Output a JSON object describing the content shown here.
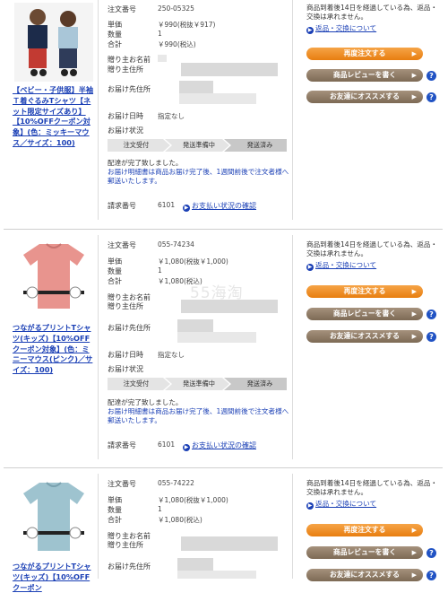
{
  "orders": [
    {
      "product_name": "【ベビー・子供服】半袖Ｔ着ぐるみTシャツ【ネット限定サイズあり】【10%OFFクーポン対象】(色：ミッキーマウス／サイズ：100)",
      "order_no_label": "注文番号",
      "order_no": "250-05325",
      "price_label": "単価",
      "price": "￥990(税抜￥917)",
      "qty_label": "数量",
      "qty": "1",
      "total_label": "合計",
      "total": "￥990(税込)",
      "recipient_name_label": "贈り主お名前",
      "recipient_address_label": "贈り主住所",
      "delivery_label": "お届け先住所",
      "delivery_date_label": "お届け日時",
      "delivery_date": "指定なし",
      "status_label": "お届け状況",
      "steps": [
        "注文受付",
        "発送準備中",
        "発送済み"
      ],
      "message_line1": "配達が完了致しました。",
      "message_line2": "お届け明細書は商品お届け完了後、1週間前後で注文者様へ郵送いたします。",
      "billing_label": "請求番号",
      "billing_no": "6101",
      "payment_link": "お支払い状況の確認",
      "return_note": "商品到着後14日を経過している為、返品・交換は承れません。",
      "return_link": "返品・交換について",
      "btn_reorder": "再度注文する",
      "btn_review": "商品レビューを書く",
      "btn_recommend": "お友達にオススメする"
    },
    {
      "product_name": "つながるプリントTシャツ(キッズ)【10%OFFクーポン対象】(色：ミニーマウス(ピンク)／サイズ：100)",
      "order_no_label": "注文番号",
      "order_no": "055-74234",
      "price_label": "単価",
      "price": "￥1,080(税抜￥1,000)",
      "qty_label": "数量",
      "qty": "1",
      "total_label": "合計",
      "total": "￥1,080(税込)",
      "recipient_name_label": "贈り主お名前",
      "recipient_address_label": "贈り主住所",
      "delivery_label": "お届け先住所",
      "delivery_date_label": "お届け日時",
      "delivery_date": "指定なし",
      "status_label": "お届け状況",
      "steps": [
        "注文受付",
        "発送準備中",
        "発送済み"
      ],
      "message_line1": "配達が完了致しました。",
      "message_line2": "お届け明細書は商品お届け完了後、1週間前後で注文者様へ郵送いたします。",
      "billing_label": "請求番号",
      "billing_no": "6101",
      "payment_link": "お支払い状況の確認",
      "return_note": "商品到着後14日を経過している為、返品・交換は承れません。",
      "return_link": "返品・交換について",
      "btn_reorder": "再度注文する",
      "btn_review": "商品レビューを書く",
      "btn_recommend": "お友達にオススメする"
    },
    {
      "product_name": "つながるプリントTシャツ(キッズ)【10%OFFクーポン",
      "order_no_label": "注文番号",
      "order_no": "055-74222",
      "price_label": "単価",
      "price": "￥1,080(税抜￥1,000)",
      "qty_label": "数量",
      "qty": "1",
      "total_label": "合計",
      "total": "￥1,080(税込)",
      "recipient_name_label": "贈り主お名前",
      "recipient_address_label": "贈り主住所",
      "delivery_label": "お届け先住所",
      "return_note": "商品到着後14日を経過している為、返品・交換は承れません。",
      "return_link": "返品・交換について",
      "btn_reorder": "再度注文する",
      "btn_review": "商品レビューを書く",
      "btn_recommend": "お友達にオススメする"
    }
  ],
  "help_icon": "?",
  "watermark": "55海淘",
  "colors": {
    "link": "#1a3fb5",
    "reorder": "#ef8f28",
    "secondary": "#8d7a64",
    "help": "#2153c4"
  }
}
